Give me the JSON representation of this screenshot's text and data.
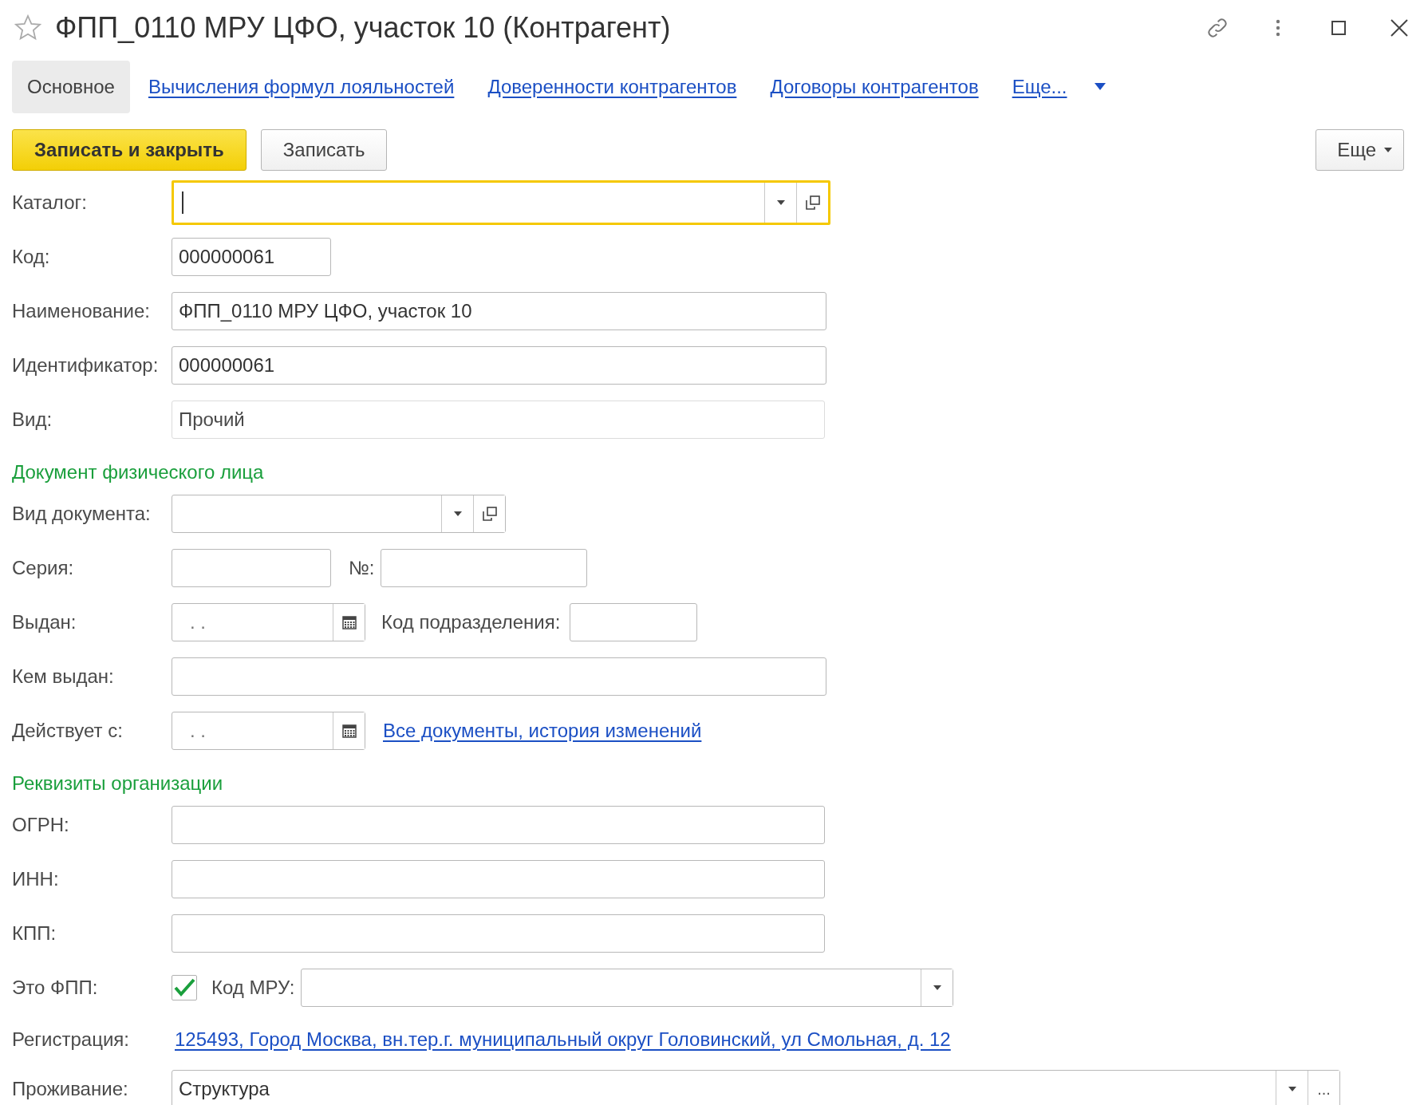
{
  "window": {
    "title": "ФПП_0110 МРУ ЦФО, участок 10 (Контрагент)",
    "favorite": false
  },
  "tabs": [
    {
      "label": "Основное",
      "selected": true,
      "kind": "tab"
    },
    {
      "label": "Вычисления формул лояльностей",
      "selected": false,
      "kind": "tab"
    },
    {
      "label": "Доверенности контрагентов",
      "selected": false,
      "kind": "tab"
    },
    {
      "label": "Договоры контрагентов",
      "selected": false,
      "kind": "tab"
    },
    {
      "label": "Еще...",
      "selected": false,
      "kind": "menu"
    }
  ],
  "toolbar": {
    "buttons": [
      {
        "label": "Записать и закрыть",
        "kind": "primary"
      },
      {
        "label": "Записать",
        "kind": "default"
      }
    ],
    "more": "Еще"
  },
  "form": {
    "catalog": {
      "label": "Каталог:",
      "focused": true
    },
    "code": {
      "label": "Код:",
      "value": "000000061"
    },
    "name": {
      "label": "Наименование:",
      "value": "ФПП_0110 МРУ ЦФО, участок 10"
    },
    "identifier": {
      "label": "Идентификатор:",
      "value": "000000061"
    },
    "type": {
      "label": "Вид:",
      "value": "Прочий",
      "disabled": true
    }
  },
  "person_document": {
    "heading": "Документ физического лица",
    "doc_type": {
      "label": "Вид документа:"
    },
    "series": {
      "label": "Серия:"
    },
    "number": {
      "label": "№:"
    },
    "issued": {
      "label": "Выдан:",
      "value": ". ."
    },
    "department_code": {
      "label": "Код подразделения:"
    },
    "issued_by": {
      "label": "Кем выдан:"
    },
    "valid_from": {
      "label": "Действует с:",
      "value": ". ."
    },
    "history_link": "Все документы, история изменений"
  },
  "organization": {
    "heading": "Реквизиты организации",
    "ogrn": {
      "label": "ОГРН:"
    },
    "inn": {
      "label": "ИНН:"
    },
    "kpp": {
      "label": "КПП:"
    },
    "is_fpp": {
      "label": "Это ФПП:",
      "checked": true
    },
    "mru_code": {
      "label": "Код МРУ:"
    },
    "registration": {
      "label": "Регистрация:",
      "address": "125493, Город Москва, вн.тер.г. муниципальный округ Головинский, ул Смольная, д. 12"
    },
    "residence": {
      "label": "Проживание:",
      "value": "Структура",
      "more_button": "..."
    }
  }
}
